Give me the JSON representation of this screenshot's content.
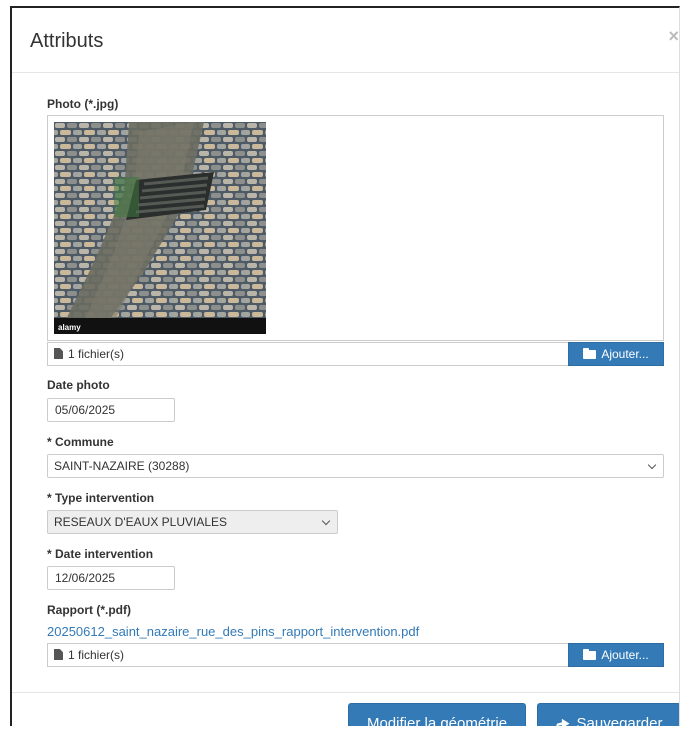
{
  "modal": {
    "title": "Attributs",
    "close_label": "×"
  },
  "photo": {
    "label": "Photo (*.jpg)",
    "file_count": "1 fichier(s)",
    "add_label": "Ajouter...",
    "watermark": "alamy"
  },
  "date_photo": {
    "label": "Date photo",
    "value": "05/06/2025"
  },
  "commune": {
    "label": "* Commune",
    "value": "SAINT-NAZAIRE (30288)"
  },
  "type_intervention": {
    "label": "* Type intervention",
    "value": "RESEAUX D'EAUX PLUVIALES"
  },
  "date_intervention": {
    "label": "* Date intervention",
    "value": "12/06/2025"
  },
  "rapport": {
    "label": "Rapport (*.pdf)",
    "file_link": "20250612_saint_nazaire_rue_des_pins_rapport_intervention.pdf",
    "file_count": "1 fichier(s)",
    "add_label": "Ajouter..."
  },
  "footer": {
    "modify_geometry_label": "Modifier la géométrie",
    "save_label": "Sauvegarder"
  },
  "colors": {
    "primary": "#337ab7",
    "link": "#337ab7",
    "disabled_bg": "#eeeeee"
  },
  "icons": [
    "close-icon",
    "file-icon",
    "folder-open-icon",
    "chevron-down-icon",
    "share-icon"
  ]
}
